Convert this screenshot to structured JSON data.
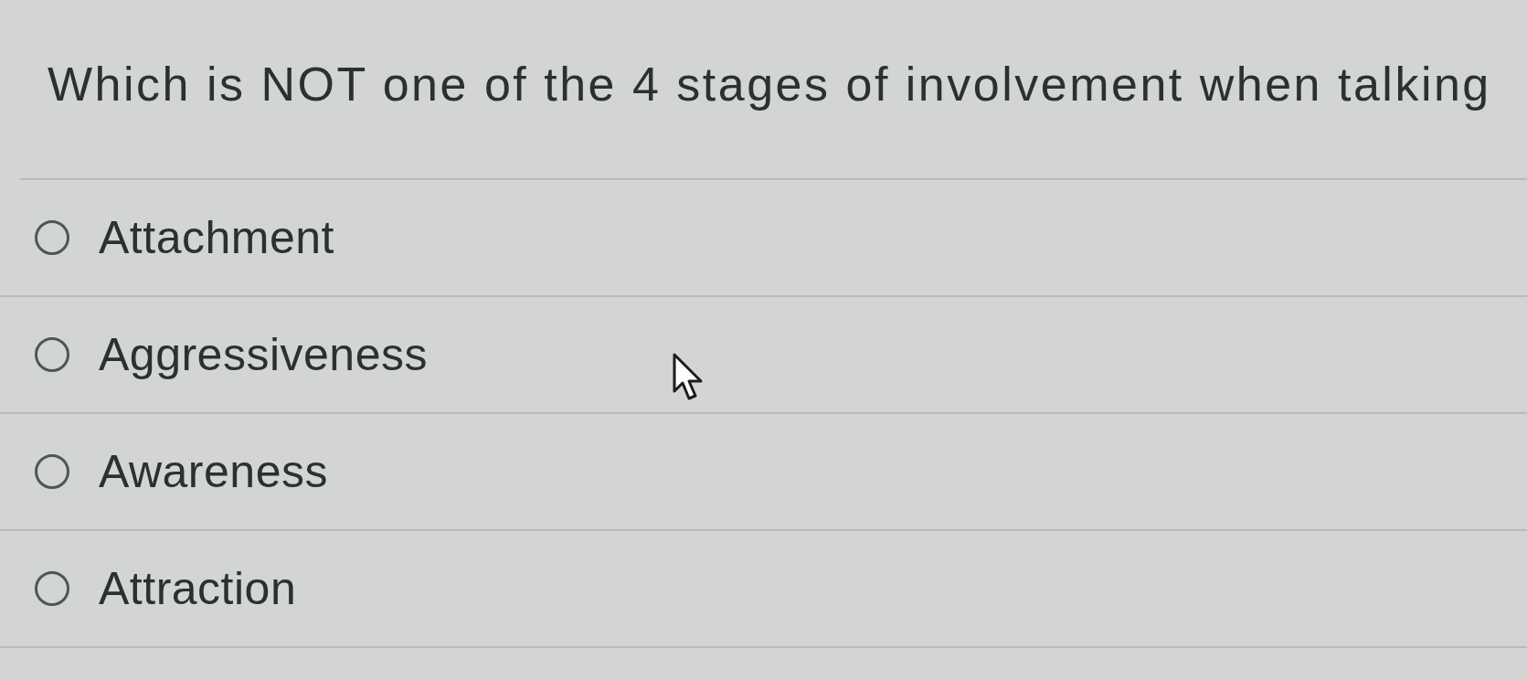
{
  "question": {
    "text": "Which is NOT one of the 4 stages of involvement when talking"
  },
  "options": [
    {
      "label": "Attachment",
      "selected": false
    },
    {
      "label": "Aggressiveness",
      "selected": false
    },
    {
      "label": "Awareness",
      "selected": false
    },
    {
      "label": "Attraction",
      "selected": false
    }
  ]
}
